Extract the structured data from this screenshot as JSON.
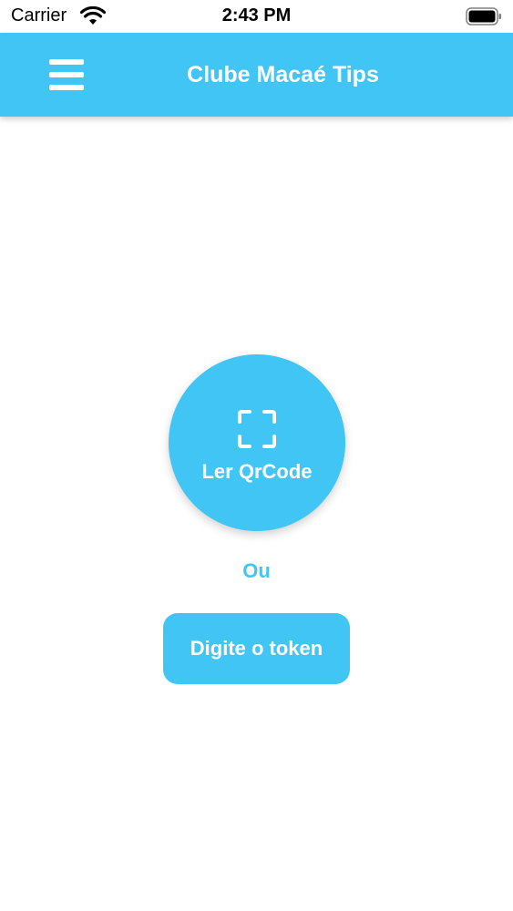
{
  "status_bar": {
    "carrier": "Carrier",
    "time": "2:43 PM",
    "icons": [
      "wifi-icon",
      "battery-icon"
    ]
  },
  "header": {
    "title": "Clube Macaé Tips",
    "menu_icon": "hamburger-menu-icon",
    "background_color": "#40c5f4"
  },
  "main": {
    "qr_button": {
      "icon": "scan-icon",
      "label": "Ler QrCode"
    },
    "separator_text": "Ou",
    "token_button": {
      "label": "Digite o token"
    }
  },
  "colors": {
    "accent": "#40c5f4",
    "on_accent": "#ffffff",
    "background": "#ffffff"
  }
}
